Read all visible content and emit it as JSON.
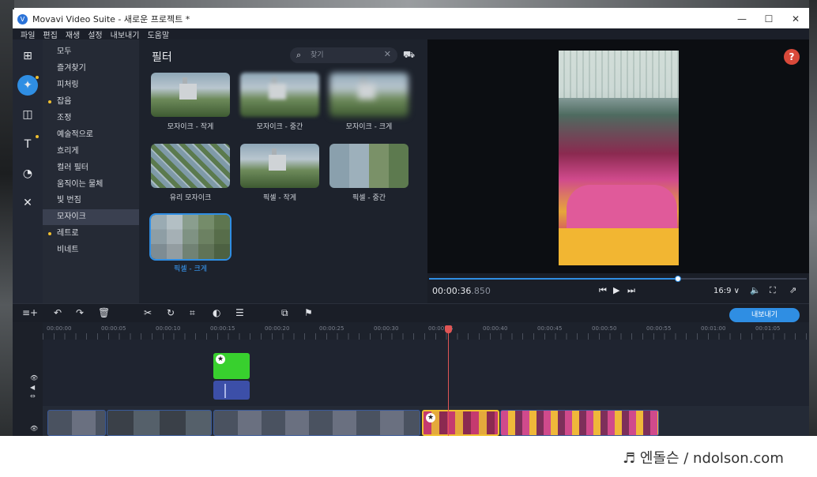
{
  "window": {
    "title": "Movavi Video Suite - 새로운 프로젝트 *",
    "app_icon": "V"
  },
  "window_controls": {
    "minimize": "—",
    "maximize": "☐",
    "close": "✕"
  },
  "menu": [
    "파일",
    "편집",
    "재생",
    "설정",
    "내보내기",
    "도움말"
  ],
  "categories": {
    "items": [
      {
        "label": "모두",
        "dot": false
      },
      {
        "label": "즐겨찾기",
        "dot": false
      },
      {
        "label": "피처링",
        "dot": false
      },
      {
        "label": "잡음",
        "dot": true
      },
      {
        "label": "조정",
        "dot": false
      },
      {
        "label": "예술적으로",
        "dot": false
      },
      {
        "label": "흐리게",
        "dot": false
      },
      {
        "label": "컬러 필터",
        "dot": false
      },
      {
        "label": "움직이는 물체",
        "dot": false
      },
      {
        "label": "빛 번짐",
        "dot": false
      },
      {
        "label": "모자이크",
        "dot": false,
        "selected": true
      },
      {
        "label": "레트로",
        "dot": true
      },
      {
        "label": "비네트",
        "dot": false
      }
    ]
  },
  "filters": {
    "title": "필터",
    "search_placeholder": "찾기",
    "tiles": [
      {
        "label": "모자이크 - 작게",
        "style": "plain"
      },
      {
        "label": "모자이크 - 중간",
        "style": "blur-m"
      },
      {
        "label": "모자이크 - 크게",
        "style": "blur-l"
      },
      {
        "label": "유리 모자이크",
        "style": "glass"
      },
      {
        "label": "픽셀 - 작게",
        "style": "plain"
      },
      {
        "label": "픽셀 - 중간",
        "style": "pix-m"
      },
      {
        "label": "픽셀 - 크게",
        "style": "pix-l",
        "selected": true
      }
    ]
  },
  "preview": {
    "timecode": "00:00:36",
    "timecode_ms": ".850",
    "progress": 0.66,
    "aspect": "16:9 ∨",
    "help": "?"
  },
  "timeline": {
    "export_label": "내보내기",
    "ruler": [
      "00:00:00",
      "00:00:05",
      "00:00:10",
      "00:00:15",
      "00:00:20",
      "00:00:25",
      "00:00:30",
      "00:00:35",
      "00:00:40",
      "00:00:45",
      "00:00:50",
      "00:00:55",
      "00:01:00",
      "00:01:05"
    ]
  },
  "watermark": "♬ 엔돌슨 / ndolson.com",
  "colors": {
    "accent": "#2f8ee3",
    "playhead": "#e05555",
    "dot": "#f0c030"
  }
}
